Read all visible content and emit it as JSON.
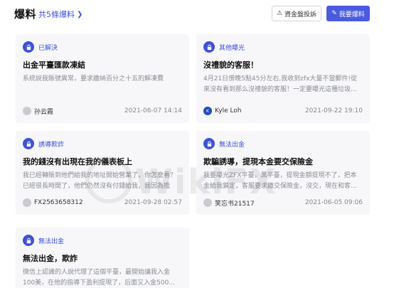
{
  "header": {
    "title": "爆料",
    "total_link": "共5條爆料",
    "complaint_button": "資金盤投訴",
    "expose_button": "我要爆料"
  },
  "watermark": {
    "text": "WikiFX"
  },
  "cards": [
    {
      "tag": "已解決",
      "title": "出金平臺匯款凍結",
      "desc": "系統說我賬號異常，要求繳納百分之十五的解凍費",
      "user": "孙云霞",
      "date": "2021-06-07 14:14"
    },
    {
      "tag": "其他曝光",
      "title": "沒禮貌的客服！",
      "desc": "4月21日傍晚5點45分左右,我收到zfx大量不當郵件!從來沒有看到那么沒禮貌的客服！一定要曝光這種垃圾...",
      "user": "Kyle Loh",
      "avatar_letter": "K",
      "date": "2021-09-22 19:10"
    },
    {
      "tag": "誘導欺詐",
      "title": "我的錢沒有出現在我的儀表板上",
      "desc": "我已經轉賬到他們給我的地址開始營業了，你怎麼看？已經很長時間了，他們仍然沒有付錢給我，我因為擔心...",
      "user": "FX2563658312",
      "date": "2021-09-28 02:57"
    },
    {
      "tag": "無法出金",
      "title": "欺騙誘導，提現本金要交保險金",
      "desc": "我要曝光ZFX平臺，黑平臺，提現金額提現不了，把本金給我鎖定，客服要求繳交保險金，沒交，現在和客...",
      "user": "笑忘书21517",
      "date": "2021-06-05 09:06"
    },
    {
      "tag": "無法出金",
      "title": "無法出金，欺詐",
      "desc": "微信上認識的人說代理了這個平臺，最開始讓我入金100美，在他的指導下盈利提現了，后面又入金500...",
      "user": "",
      "date": ""
    }
  ]
}
